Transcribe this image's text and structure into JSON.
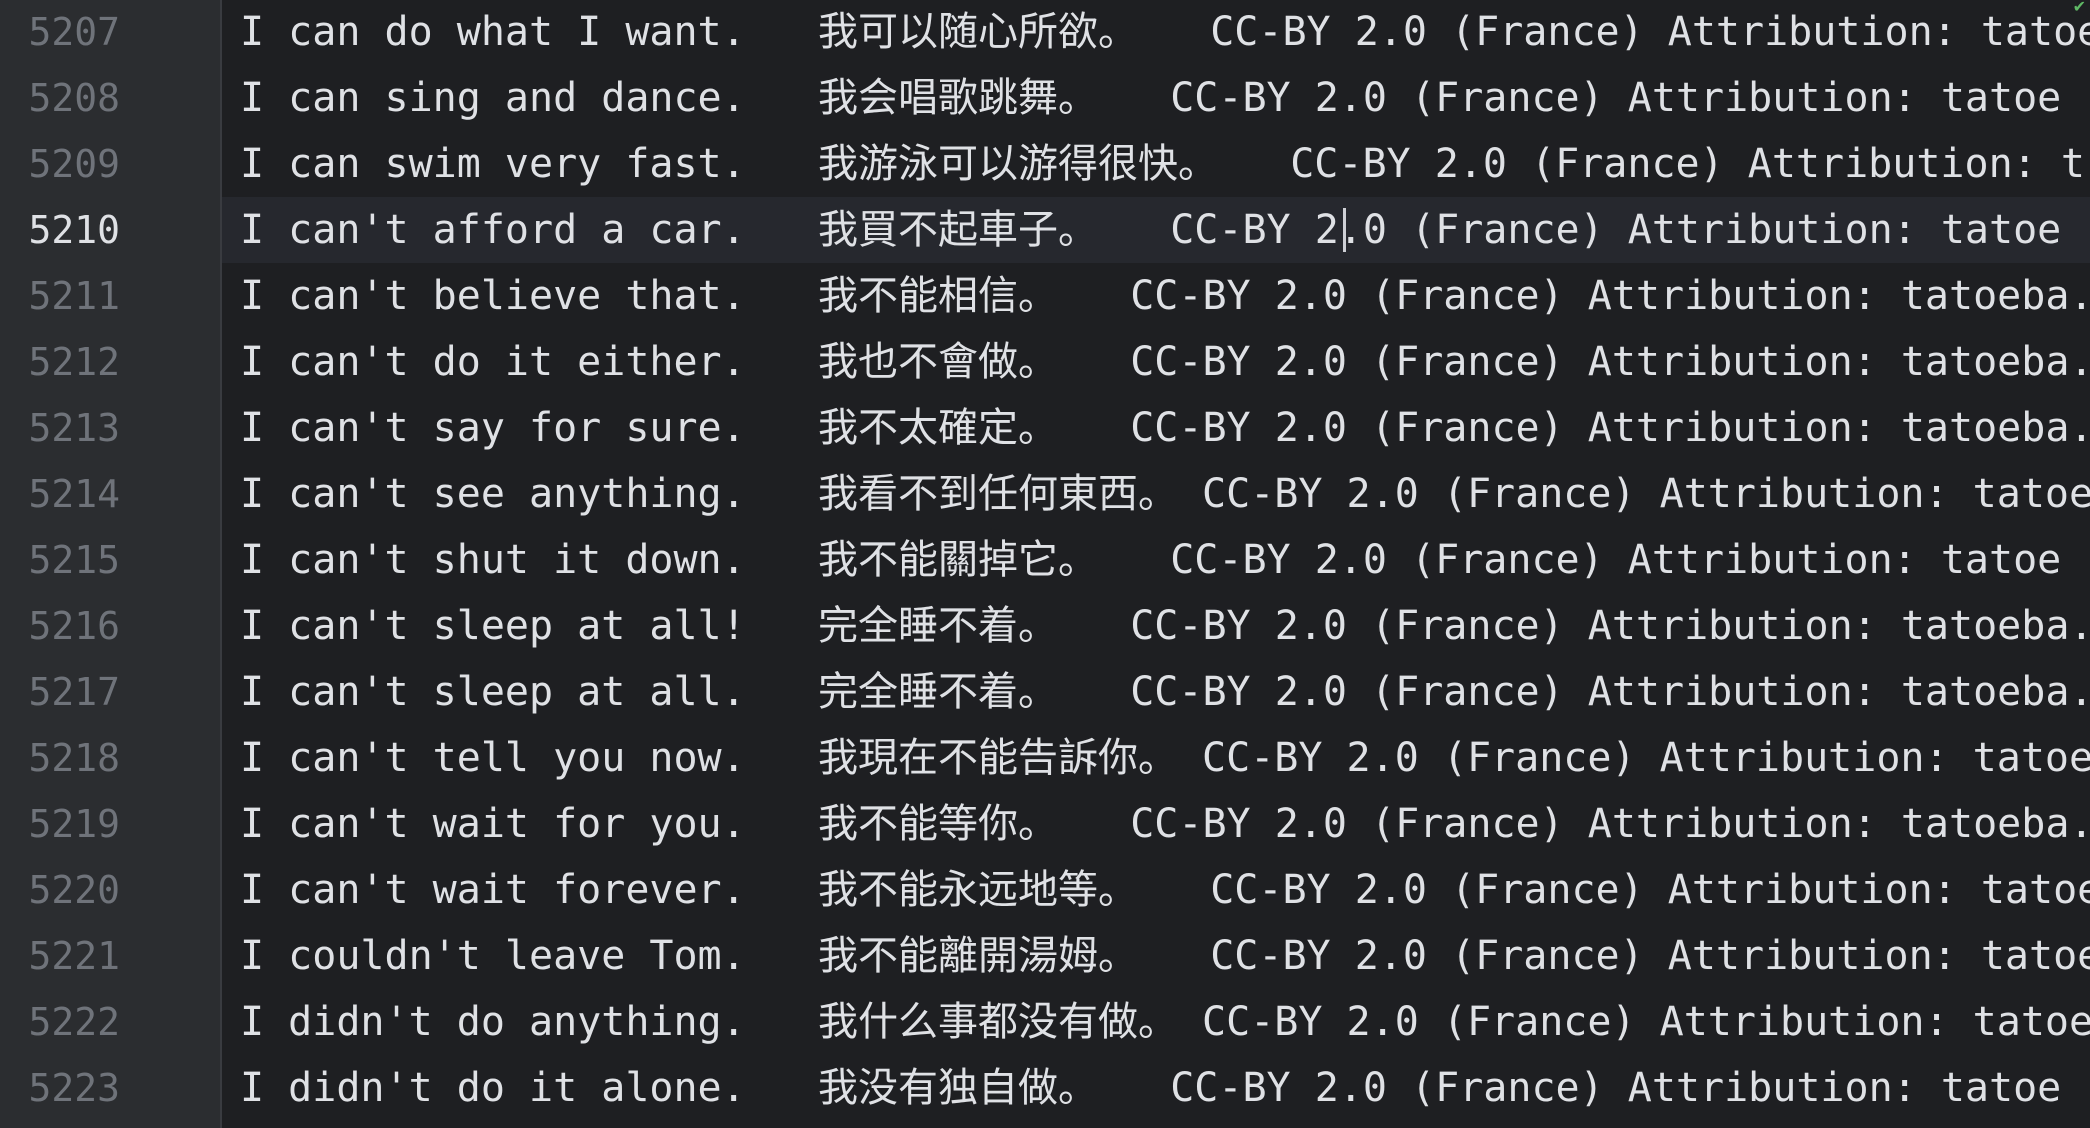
{
  "editor": {
    "current_line": "5210",
    "lines": [
      {
        "number": "5207",
        "text": "I can do what I want.   我可以随心所欲。   CC-BY 2.0 (France) Attribution: tatoe"
      },
      {
        "number": "5208",
        "text": "I can sing and dance.   我会唱歌跳舞。   CC-BY 2.0 (France) Attribution: tatoe"
      },
      {
        "number": "5209",
        "text": "I can swim very fast.   我游泳可以游得很快。   CC-BY 2.0 (France) Attribution: t"
      },
      {
        "number": "5210",
        "text": "I can't afford a car.   我買不起車子。   CC-BY 2.0 (France) Attribution: tatoe"
      },
      {
        "number": "5211",
        "text": "I can't believe that.   我不能相信。   CC-BY 2.0 (France) Attribution: tatoeba.o"
      },
      {
        "number": "5212",
        "text": "I can't do it either.   我也不會做。   CC-BY 2.0 (France) Attribution: tatoeba.o"
      },
      {
        "number": "5213",
        "text": "I can't say for sure.   我不太確定。   CC-BY 2.0 (France) Attribution: tatoeba.o"
      },
      {
        "number": "5214",
        "text": "I can't see anything.   我看不到任何東西。 CC-BY 2.0 (France) Attribution: tatoe"
      },
      {
        "number": "5215",
        "text": "I can't shut it down.   我不能關掉它。   CC-BY 2.0 (France) Attribution: tatoe"
      },
      {
        "number": "5216",
        "text": "I can't sleep at all!   完全睡不着。   CC-BY 2.0 (France) Attribution: tatoeba.o"
      },
      {
        "number": "5217",
        "text": "I can't sleep at all.   完全睡不着。   CC-BY 2.0 (France) Attribution: tatoeba.o"
      },
      {
        "number": "5218",
        "text": "I can't tell you now.   我現在不能告訴你。 CC-BY 2.0 (France) Attribution: tatoe"
      },
      {
        "number": "5219",
        "text": "I can't wait for you.   我不能等你。   CC-BY 2.0 (France) Attribution: tatoeba.o"
      },
      {
        "number": "5220",
        "text": "I can't wait forever.   我不能永远地等。   CC-BY 2.0 (France) Attribution: tatoe"
      },
      {
        "number": "5221",
        "text": "I couldn't leave Tom.   我不能離開湯姆。   CC-BY 2.0 (France) Attribution: tatoe"
      },
      {
        "number": "5222",
        "text": "I didn't do anything.   我什么事都没有做。 CC-BY 2.0 (France) Attribution: tatoe"
      },
      {
        "number": "5223",
        "text": "I didn't do it alone.   我没有独自做。   CC-BY 2.0 (France) Attribution: tatoe"
      }
    ]
  },
  "colors": {
    "gutter_bg": "#2b2d30",
    "editor_bg": "#1e1f22",
    "text": "#dfe1e5",
    "line_number": "#6f737a",
    "current_line_number": "#dfe1e5",
    "status_ok": "#5fb865"
  },
  "icons": {
    "inspection_status": "checkmark-icon"
  }
}
